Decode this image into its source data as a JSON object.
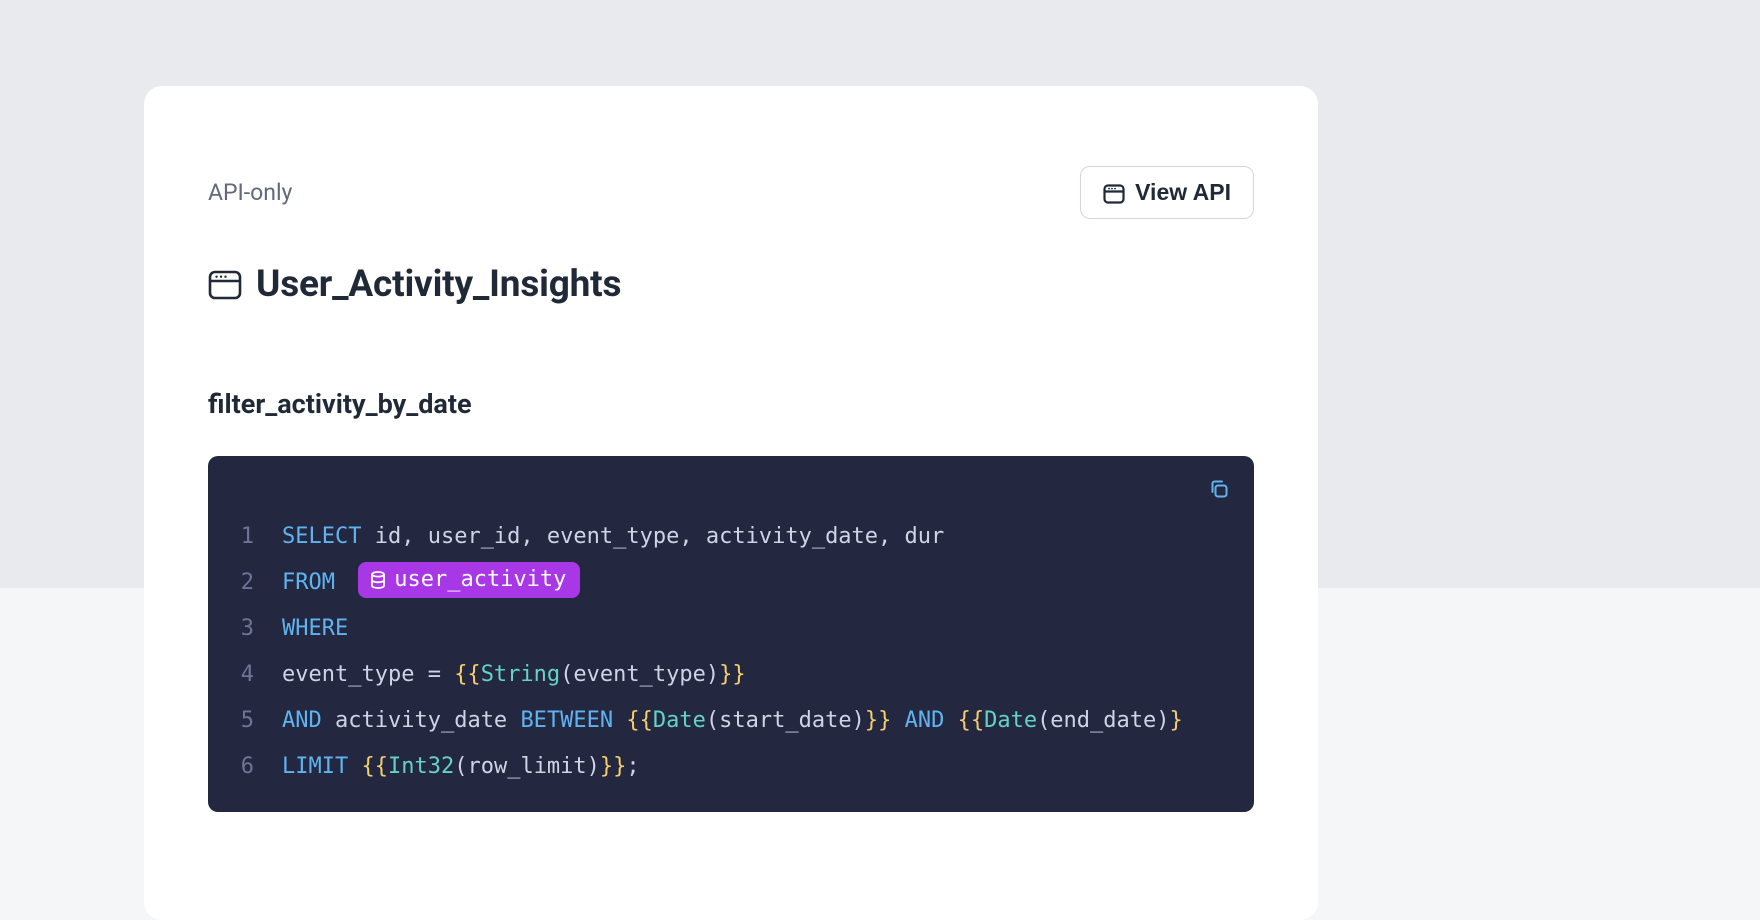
{
  "header": {
    "api_only_label": "API-only",
    "view_api_label": "View API"
  },
  "title": "User_Activity_Insights",
  "section_heading": "filter_activity_by_date",
  "code": {
    "table_name": "user_activity",
    "lines": {
      "l1": {
        "num": "1",
        "kw": "SELECT",
        "rest": " id, user_id, event_type, activity_date, dur"
      },
      "l2": {
        "num": "2",
        "kw": "FROM"
      },
      "l3": {
        "num": "3",
        "kw": "WHERE"
      },
      "l4": {
        "num": "4",
        "indent": "  event_type = ",
        "br_o": "{{",
        "type": "String",
        "args": "(event_type)",
        "br_c": "}}"
      },
      "l5": {
        "num": "5",
        "kw1": "AND",
        "t1": " activity_date ",
        "kw2": "BETWEEN",
        "sp": " ",
        "br_o1": "{{",
        "type1": "Date",
        "args1": "(start_date)",
        "br_c1": "}}",
        "kw3": " AND ",
        "br_o2": "{{",
        "type2": "Date",
        "args2": "(end_date)",
        "br_c2": "}"
      },
      "l6": {
        "num": "6",
        "kw": "LIMIT",
        "sp": " ",
        "br_o": "{{",
        "type": "Int32",
        "args": "(row_limit)",
        "br_c": "}}",
        "tail": ";"
      }
    }
  }
}
